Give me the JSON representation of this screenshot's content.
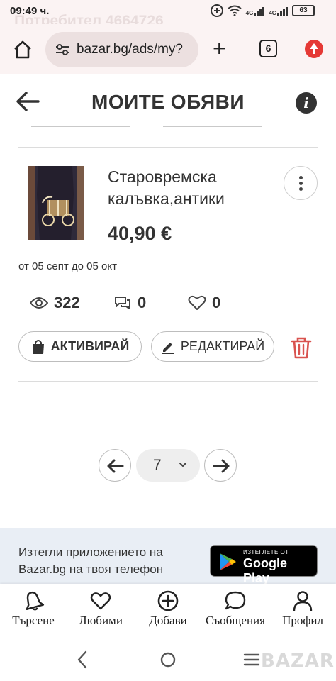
{
  "status_bar": {
    "time": "09:49 ч.",
    "battery": "63",
    "network_1": "4G",
    "network_2": "4G",
    "ghost_text": "Потребител 4664726"
  },
  "browser": {
    "url": "bazar.bg/ads/my?",
    "tab_count": "6"
  },
  "header": {
    "title": "МОИТЕ ОБЯВИ"
  },
  "listing": {
    "title_line1": "Старовремска",
    "title_line2": "калъвка,антики",
    "price": "40,90 €",
    "dates": "от 05 септ до 05 окт",
    "views": "322",
    "messages": "0",
    "favorites": "0",
    "activate_label": "АКТИВИРАЙ",
    "edit_label": "РЕДАКТИРАЙ"
  },
  "pagination": {
    "current_page": "7"
  },
  "app_banner": {
    "text_line1": "Изтегли приложението на",
    "text_line2": "Bazar.bg на твоя телефон",
    "store_small": "ИЗТЕГЛЕТЕ ОТ",
    "store_big": "Google Play"
  },
  "bottom_nav": {
    "items": [
      {
        "label": "Търсене",
        "icon": "bell-icon"
      },
      {
        "label": "Любими",
        "icon": "heart-icon"
      },
      {
        "label": "Добави",
        "icon": "plus-circle-icon"
      },
      {
        "label": "Съобщения",
        "icon": "chat-icon"
      },
      {
        "label": "Профил",
        "icon": "user-icon"
      }
    ]
  },
  "system": {
    "watermark": "BAZAR"
  },
  "colors": {
    "accent_red": "#e53935",
    "trash_red": "#d9534f",
    "text": "#333333",
    "banner_bg": "#e9eef5"
  }
}
